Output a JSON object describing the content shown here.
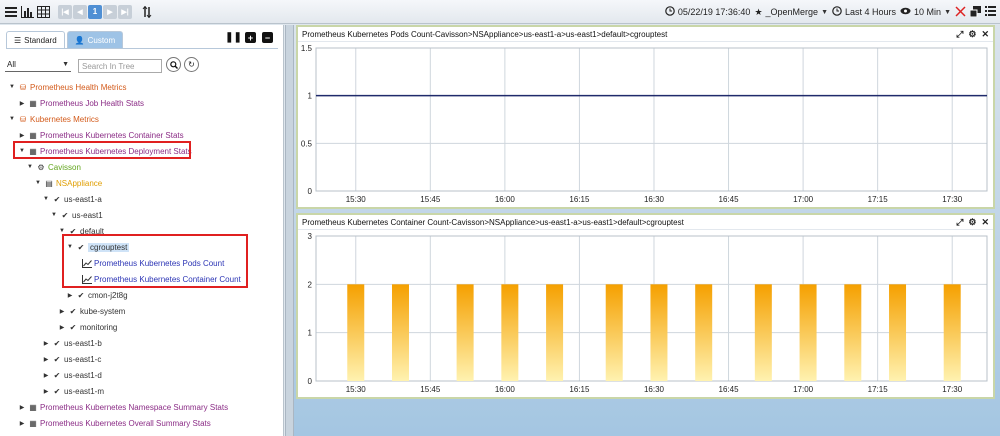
{
  "toolbar": {
    "datetime": "05/22/19 17:36:40",
    "favorite": "_OpenMerge",
    "time_range": "Last 4 Hours",
    "interval": "10 Min",
    "page_number": "1"
  },
  "left_panel": {
    "tabs": [
      {
        "label": "Standard",
        "active": true
      },
      {
        "label": "Custom",
        "active": false
      }
    ],
    "filter_value": "All",
    "search_placeholder": "Search In Tree",
    "tree": [
      {
        "label": "Prometheus Health Metrics",
        "color": "orange",
        "icon": "db"
      },
      {
        "label": "Prometheus Job Health Stats",
        "color": "purple",
        "icon": "grid"
      },
      {
        "label": "Kubernetes Metrics",
        "color": "orange",
        "icon": "db"
      },
      {
        "label": "Prometheus Kubernetes Container Stats",
        "color": "purple",
        "icon": "grid"
      },
      {
        "label": "Prometheus Kubernetes Deployment Stats",
        "color": "purple",
        "icon": "grid"
      },
      {
        "label": "Cavisson",
        "color": "green",
        "icon": "cogs"
      },
      {
        "label": "NSAppliance",
        "color": "yellow",
        "icon": "server"
      },
      {
        "label": "us-east1-a",
        "color": "dark",
        "icon": "check"
      },
      {
        "label": "us-east1",
        "color": "dark",
        "icon": "check"
      },
      {
        "label": "default",
        "color": "dark",
        "icon": "check"
      },
      {
        "label": "cgrouptest",
        "color": "dark",
        "icon": "check"
      },
      {
        "label": "Prometheus Kubernetes Pods Count",
        "color": "blue",
        "icon": "chart"
      },
      {
        "label": "Prometheus Kubernetes Container Count",
        "color": "blue",
        "icon": "chart"
      },
      {
        "label": "cmon-j2t8g",
        "color": "dark",
        "icon": "check"
      },
      {
        "label": "kube-system",
        "color": "dark",
        "icon": "check"
      },
      {
        "label": "monitoring",
        "color": "dark",
        "icon": "check"
      },
      {
        "label": "us-east1-b",
        "color": "dark",
        "icon": "check"
      },
      {
        "label": "us-east1-c",
        "color": "dark",
        "icon": "check"
      },
      {
        "label": "us-east1-d",
        "color": "dark",
        "icon": "check"
      },
      {
        "label": "us-east1-m",
        "color": "dark",
        "icon": "check"
      },
      {
        "label": "Prometheus Kubernetes Namespace Summary Stats",
        "color": "purple",
        "icon": "grid"
      },
      {
        "label": "Prometheus Kubernetes Overall Summary Stats",
        "color": "purple",
        "icon": "grid"
      }
    ]
  },
  "colors": {
    "line": "#1f2a6b",
    "bar_top": "#f5a000",
    "bar_bottom": "#fff2b0",
    "purple": "#8b2c86",
    "orange": "#d35a1a",
    "highlight": "#e02020"
  },
  "chart_data": [
    {
      "type": "line",
      "title": "Prometheus Kubernetes Pods Count-Cavisson>NSAppliance>us-east1-a>us-east1>default>cgrouptest",
      "x_ticks": [
        "15:30",
        "15:45",
        "16:00",
        "16:15",
        "16:30",
        "16:45",
        "17:00",
        "17:15",
        "17:30"
      ],
      "y_ticks": [
        "0",
        "0.5",
        "1",
        "1.5"
      ],
      "ylim": [
        0,
        1.5
      ],
      "x_range": [
        "15:22",
        "17:37"
      ],
      "series": [
        {
          "x": [
            "15:22",
            "17:37"
          ],
          "values": [
            1,
            1
          ]
        }
      ]
    },
    {
      "type": "bar",
      "title": "Prometheus Kubernetes Container Count-Cavisson>NSAppliance>us-east1-a>us-east1>default>cgrouptest",
      "x_ticks": [
        "15:30",
        "15:45",
        "16:00",
        "16:15",
        "16:30",
        "16:45",
        "17:00",
        "17:15",
        "17:30"
      ],
      "y_ticks": [
        "0",
        "1",
        "2",
        "3"
      ],
      "ylim": [
        0,
        3
      ],
      "categories": [
        "15:30",
        "15:39",
        "15:52",
        "16:01",
        "16:10",
        "16:22",
        "16:31",
        "16:40",
        "16:52",
        "17:01",
        "17:10",
        "17:19",
        "17:30"
      ],
      "values": [
        2,
        2,
        2,
        2,
        2,
        2,
        2,
        2,
        2,
        2,
        2,
        2,
        2
      ]
    }
  ]
}
